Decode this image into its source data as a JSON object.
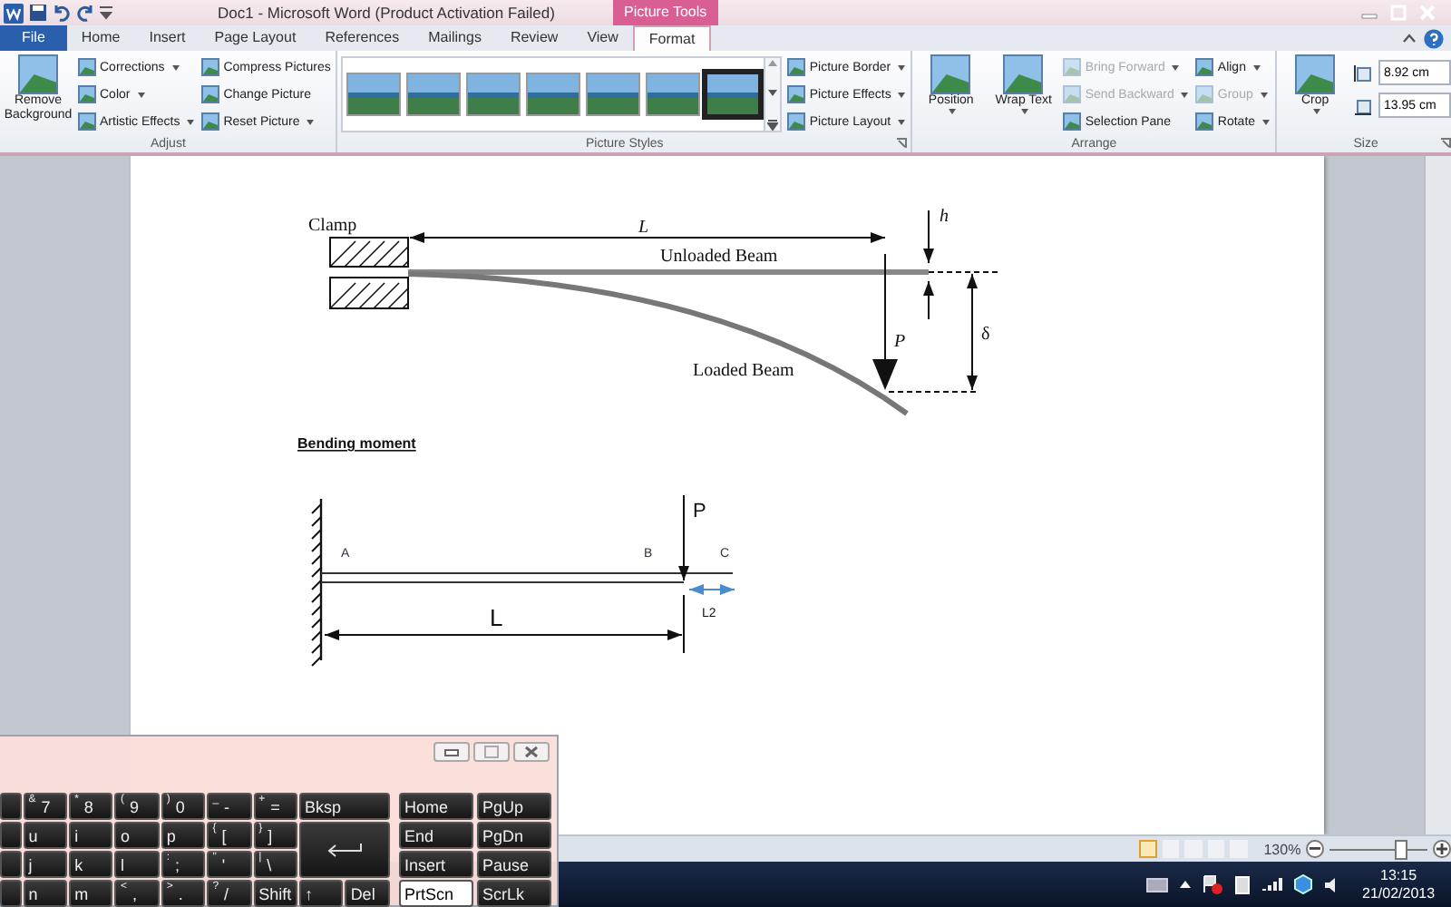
{
  "title_bar": {
    "title": "Doc1  -  Microsoft Word (Product Activation Failed)",
    "context_label": "Picture Tools"
  },
  "tabs": [
    {
      "label": "File",
      "kind": "file",
      "selected": false
    },
    {
      "label": "Home",
      "kind": "tab",
      "selected": false
    },
    {
      "label": "Insert",
      "kind": "tab",
      "selected": false
    },
    {
      "label": "Page Layout",
      "kind": "tab",
      "selected": false
    },
    {
      "label": "References",
      "kind": "tab",
      "selected": false
    },
    {
      "label": "Mailings",
      "kind": "tab",
      "selected": false
    },
    {
      "label": "Review",
      "kind": "tab",
      "selected": false
    },
    {
      "label": "View",
      "kind": "tab",
      "selected": false
    },
    {
      "label": "Format",
      "kind": "context",
      "selected": true
    }
  ],
  "ribbon": [
    {
      "label": "Adjust",
      "launcher": false,
      "large": [
        {
          "label": "Remove Background",
          "caret": false
        }
      ],
      "columns": [
        [
          {
            "label": "Corrections",
            "caret": true,
            "disabled": false
          },
          {
            "label": "Color",
            "caret": true,
            "disabled": false
          },
          {
            "label": "Artistic Effects",
            "caret": true,
            "disabled": false
          }
        ],
        [
          {
            "label": "Compress Pictures",
            "caret": false,
            "disabled": false
          },
          {
            "label": "Change Picture",
            "caret": false,
            "disabled": false
          },
          {
            "label": "Reset Picture",
            "caret": true,
            "disabled": false
          }
        ]
      ]
    },
    {
      "label": "Picture Styles",
      "launcher": true,
      "gallery": true,
      "columns": [
        [
          {
            "label": "Picture Border",
            "caret": true,
            "disabled": false
          },
          {
            "label": "Picture Effects",
            "caret": true,
            "disabled": false
          },
          {
            "label": "Picture Layout",
            "caret": true,
            "disabled": false
          }
        ]
      ]
    },
    {
      "label": "Arrange",
      "launcher": false,
      "large": [
        {
          "label": "Position",
          "caret": true
        },
        {
          "label": "Wrap Text",
          "caret": true
        }
      ],
      "columns": [
        [
          {
            "label": "Bring Forward",
            "caret": true,
            "disabled": true
          },
          {
            "label": "Send Backward",
            "caret": true,
            "disabled": true
          },
          {
            "label": "Selection Pane",
            "caret": false,
            "disabled": false
          }
        ],
        [
          {
            "label": "Align",
            "caret": true,
            "disabled": false
          },
          {
            "label": "Group",
            "caret": true,
            "disabled": true
          },
          {
            "label": "Rotate",
            "caret": true,
            "disabled": false
          }
        ]
      ]
    },
    {
      "label": "Size",
      "launcher": true,
      "large": [
        {
          "label": "Crop",
          "caret": true
        }
      ],
      "fields": [
        {
          "value": "8.92 cm"
        },
        {
          "value": "13.95 cm"
        }
      ]
    }
  ],
  "document": {
    "beam_diagram": {
      "clamp": "Clamp",
      "length": "L",
      "unloaded": "Unloaded Beam",
      "height": "h",
      "load": "P",
      "deflection": "δ",
      "loaded": "Loaded Beam"
    },
    "heading": "Bending moment",
    "moment_diagram": {
      "load": "P",
      "points": [
        "A",
        "B",
        "C"
      ],
      "length": "L",
      "overhang": "L2"
    }
  },
  "keyboard": {
    "main_rows": [
      [
        {
          "kind": "stub"
        },
        {
          "kind": "char",
          "label": "7",
          "shift": "&"
        },
        {
          "kind": "char",
          "label": "8",
          "shift": "*"
        },
        {
          "kind": "char",
          "label": "9",
          "shift": "("
        },
        {
          "kind": "char",
          "label": "0",
          "shift": ")"
        },
        {
          "kind": "char",
          "label": "-",
          "shift": "_"
        },
        {
          "kind": "char",
          "label": "=",
          "shift": "+"
        },
        {
          "kind": "wide",
          "label": "Bksp"
        }
      ],
      [
        {
          "kind": "stub"
        },
        {
          "kind": "char",
          "label": "u"
        },
        {
          "kind": "char",
          "label": "i"
        },
        {
          "kind": "char",
          "label": "o"
        },
        {
          "kind": "char",
          "label": "p"
        },
        {
          "kind": "char",
          "label": "[",
          "shift": "{"
        },
        {
          "kind": "char",
          "label": "]",
          "shift": "}"
        },
        {
          "kind": "enter"
        }
      ],
      [
        {
          "kind": "stub"
        },
        {
          "kind": "char",
          "label": "j"
        },
        {
          "kind": "char",
          "label": "k"
        },
        {
          "kind": "char",
          "label": "l"
        },
        {
          "kind": "char",
          "label": ";",
          "shift": ":"
        },
        {
          "kind": "char",
          "label": "'",
          "shift": "\""
        },
        {
          "kind": "char",
          "label": "\\",
          "shift": "|"
        }
      ],
      [
        {
          "kind": "stub"
        },
        {
          "kind": "char",
          "label": "n"
        },
        {
          "kind": "char",
          "label": "m"
        },
        {
          "kind": "char",
          "label": ",",
          "shift": "<"
        },
        {
          "kind": "char",
          "label": ".",
          "shift": ">"
        },
        {
          "kind": "char",
          "label": "/",
          "shift": "?"
        },
        {
          "kind": "char",
          "label": "Shift"
        },
        {
          "kind": "char",
          "label": "↑"
        },
        {
          "kind": "char",
          "label": "Del"
        }
      ]
    ],
    "nav_rows": [
      [
        {
          "label": "Home",
          "on": false
        },
        {
          "label": "PgUp",
          "on": false
        }
      ],
      [
        {
          "label": "End",
          "on": false
        },
        {
          "label": "PgDn",
          "on": false
        }
      ],
      [
        {
          "label": "Insert",
          "on": false
        },
        {
          "label": "Pause",
          "on": false
        }
      ],
      [
        {
          "label": "PrtScn",
          "on": true
        },
        {
          "label": "ScrLk",
          "on": false
        }
      ]
    ]
  },
  "status_bar": {
    "views": [
      {
        "selected": true
      },
      {
        "selected": false
      },
      {
        "selected": false
      },
      {
        "selected": false
      },
      {
        "selected": false
      }
    ],
    "zoom": {
      "reading": "130%",
      "level": 0.72
    }
  },
  "taskbar": {
    "time": "13:15",
    "date": "21/02/2013"
  }
}
